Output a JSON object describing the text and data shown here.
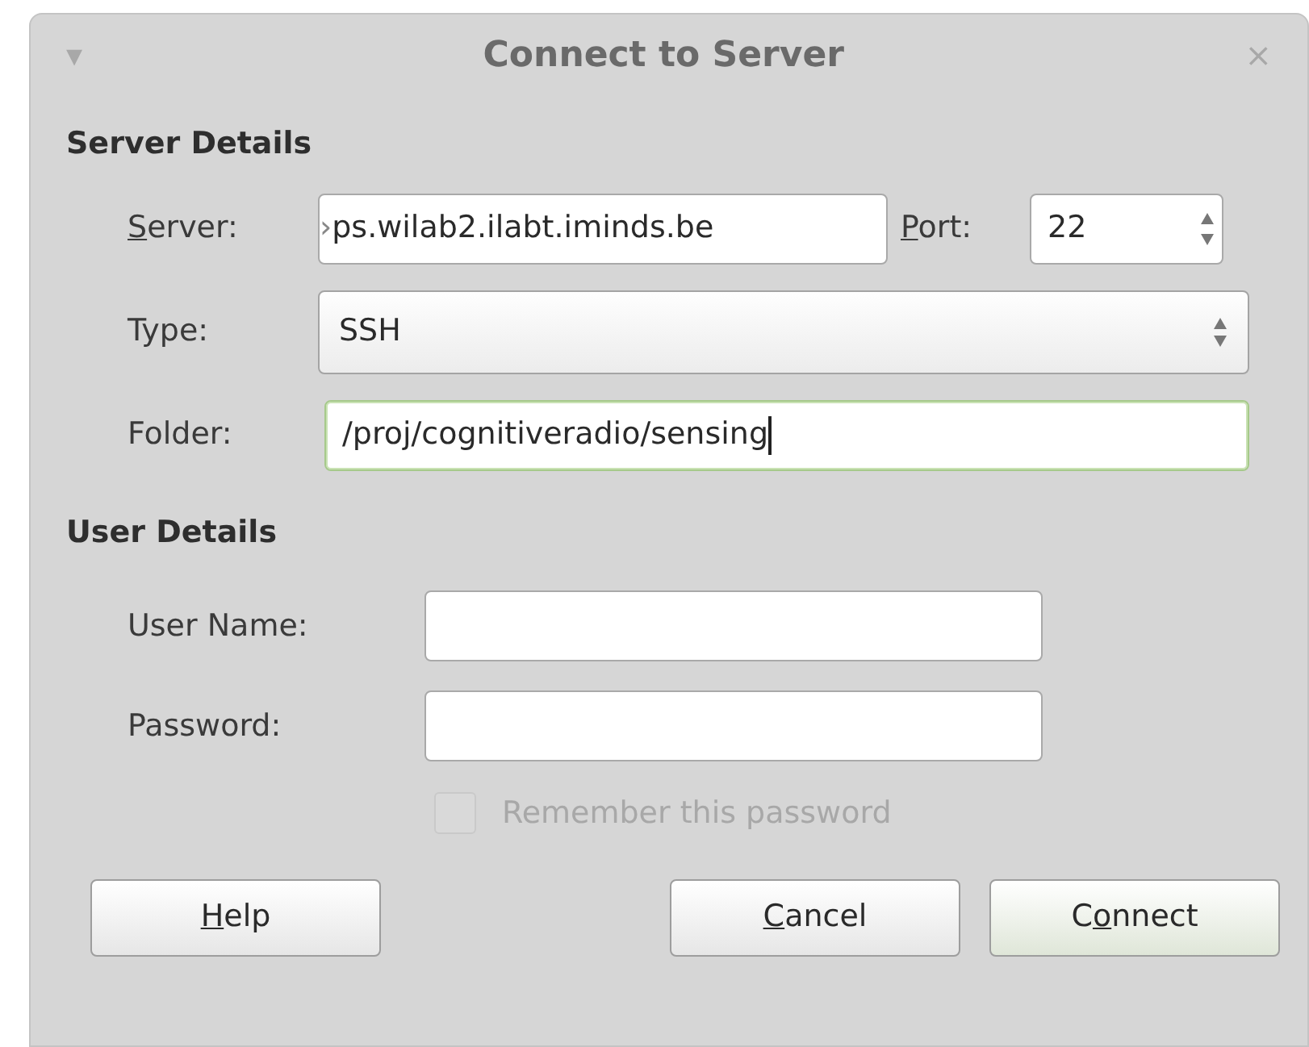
{
  "window": {
    "title": "Connect to Server",
    "menu_glyph": "▾",
    "close_glyph": "×"
  },
  "server_details": {
    "heading": "Server Details",
    "server": {
      "label": {
        "key": "S",
        "after": "erver:"
      },
      "value": "ps.wilab2.ilabt.iminds.be",
      "cut_glyph": "›"
    },
    "port": {
      "label": {
        "key": "P",
        "after": "ort:"
      },
      "value": "22"
    },
    "type": {
      "label": {
        "before": "Type:"
      },
      "value": "SSH"
    },
    "folder": {
      "label": {
        "before": "Folder:"
      },
      "value": "/proj/cognitiveradio/sensing",
      "focused": true
    }
  },
  "user_details": {
    "heading": "User Details",
    "fields": [
      {
        "label": "User Name:"
      },
      {
        "label": "Password:"
      }
    ],
    "remember": {
      "label": "Remember this password",
      "checked": false,
      "disabled": true
    }
  },
  "buttons": [
    {
      "key": "H",
      "after": "elp",
      "kind": "help"
    },
    {
      "key": "C",
      "after": "ancel",
      "kind": "action"
    },
    {
      "before": "C",
      "key": "o",
      "after": "nnect",
      "kind": "default"
    }
  ]
}
